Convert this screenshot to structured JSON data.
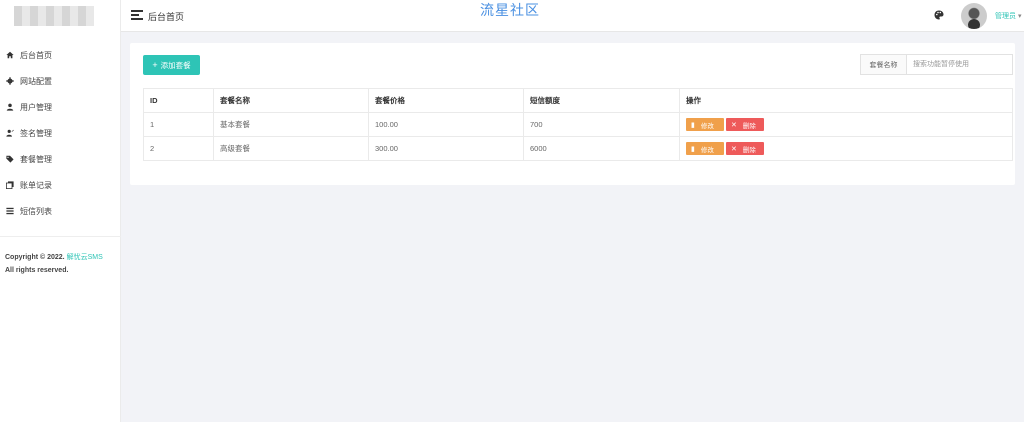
{
  "topbar": {
    "breadcrumb": "后台首页",
    "site_title": "流星社区",
    "admin_name": "管理员",
    "icons": [
      "hamburger-icon",
      "palette-icon",
      "avatar",
      "caret-down-icon"
    ]
  },
  "sidebar": {
    "items": [
      {
        "label": "后台首页",
        "icon": "home-icon"
      },
      {
        "label": "网站配置",
        "icon": "gear-icon"
      },
      {
        "label": "用户管理",
        "icon": "user-icon"
      },
      {
        "label": "签名管理",
        "icon": "user-sign-icon"
      },
      {
        "label": "套餐管理",
        "icon": "tag-icon"
      },
      {
        "label": "账单记录",
        "icon": "bill-icon"
      },
      {
        "label": "短信列表",
        "icon": "list-icon"
      }
    ],
    "copyright_prefix": "Copyright © 2022.",
    "copyright_brand": "解忧云SMS",
    "copyright_suffix": "All rights reserved."
  },
  "toolbar": {
    "add_label": "添加套餐",
    "search_label": "套餐名称",
    "search_placeholder": "搜索功能暂停使用"
  },
  "table": {
    "headers": [
      "ID",
      "套餐名称",
      "套餐价格",
      "短信额度",
      "操作"
    ],
    "rows": [
      {
        "id": "1",
        "name": "基本套餐",
        "price": "100.00",
        "quota": "700"
      },
      {
        "id": "2",
        "name": "高级套餐",
        "price": "300.00",
        "quota": "6000"
      }
    ],
    "edit_label": "修改",
    "delete_label": "删除"
  },
  "colors": {
    "accent": "#2ec4b6",
    "edit": "#f0a04b",
    "delete": "#ee5a5a",
    "title": "#4a90e2"
  }
}
